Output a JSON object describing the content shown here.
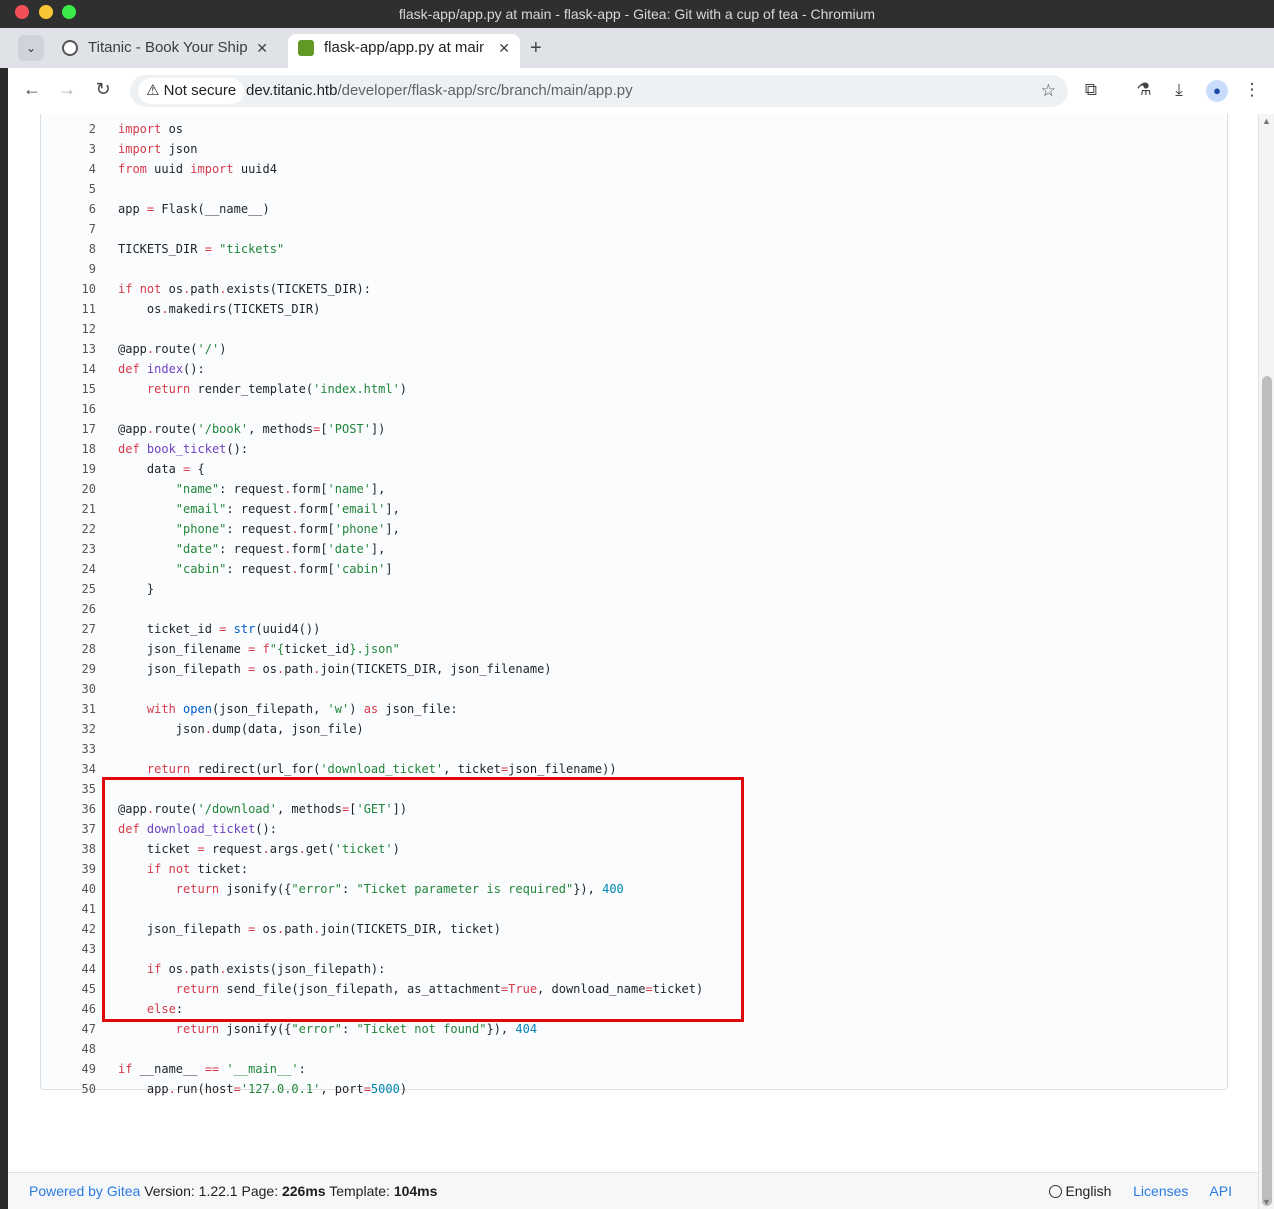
{
  "window": {
    "title": "flask-app/app.py at main - flask-app - Gitea: Git with a cup of tea - Chromium"
  },
  "tabs": [
    {
      "title": "Titanic - Book Your Ship T",
      "close": "✕"
    },
    {
      "title": "flask-app/app.py at main",
      "close": "✕"
    }
  ],
  "toolbar": {
    "not_secure": "Not secure",
    "url_host": "dev.titanic.htb",
    "url_path": "/developer/flask-app/src/branch/main/app.py"
  },
  "code": {
    "lines": [
      {
        "n": "2",
        "t": [
          [
            "k",
            "import"
          ],
          [
            "",
            " os"
          ]
        ]
      },
      {
        "n": "3",
        "t": [
          [
            "k",
            "import"
          ],
          [
            "",
            " json"
          ]
        ]
      },
      {
        "n": "4",
        "t": [
          [
            "k",
            "from"
          ],
          [
            "",
            " uuid "
          ],
          [
            "k",
            "import"
          ],
          [
            "",
            " uuid4"
          ]
        ]
      },
      {
        "n": "5",
        "t": []
      },
      {
        "n": "6",
        "t": [
          [
            "",
            "app "
          ],
          [
            "k",
            "="
          ],
          [
            "",
            " Flask(__name__)"
          ]
        ]
      },
      {
        "n": "7",
        "t": []
      },
      {
        "n": "8",
        "t": [
          [
            "",
            "TICKETS_DIR "
          ],
          [
            "k",
            "="
          ],
          [
            "",
            " "
          ],
          [
            "s",
            "\"tickets\""
          ]
        ]
      },
      {
        "n": "9",
        "t": []
      },
      {
        "n": "10",
        "t": [
          [
            "k",
            "if"
          ],
          [
            "",
            " "
          ],
          [
            "k",
            "not"
          ],
          [
            "",
            " os"
          ],
          [
            "k",
            "."
          ],
          [
            "",
            "path"
          ],
          [
            "k",
            "."
          ],
          [
            "",
            "exists(TICKETS_DIR):"
          ]
        ]
      },
      {
        "n": "11",
        "t": [
          [
            "",
            "    os"
          ],
          [
            "k",
            "."
          ],
          [
            "",
            "makedirs(TICKETS_DIR)"
          ]
        ]
      },
      {
        "n": "12",
        "t": []
      },
      {
        "n": "13",
        "t": [
          [
            "",
            "@app"
          ],
          [
            "k",
            "."
          ],
          [
            "",
            "route("
          ],
          [
            "s",
            "'/'"
          ],
          [
            "",
            ")"
          ]
        ]
      },
      {
        "n": "14",
        "t": [
          [
            "k",
            "def"
          ],
          [
            "",
            " "
          ],
          [
            "f",
            "index"
          ],
          [
            "",
            "():"
          ]
        ]
      },
      {
        "n": "15",
        "t": [
          [
            "",
            "    "
          ],
          [
            "k",
            "return"
          ],
          [
            "",
            " render_template("
          ],
          [
            "s",
            "'index.html'"
          ],
          [
            "",
            ")"
          ]
        ]
      },
      {
        "n": "16",
        "t": []
      },
      {
        "n": "17",
        "t": [
          [
            "",
            "@app"
          ],
          [
            "k",
            "."
          ],
          [
            "",
            "route("
          ],
          [
            "s",
            "'/book'"
          ],
          [
            "",
            ", methods"
          ],
          [
            "k",
            "="
          ],
          [
            "",
            "["
          ],
          [
            "s",
            "'POST'"
          ],
          [
            "",
            "])"
          ]
        ]
      },
      {
        "n": "18",
        "t": [
          [
            "k",
            "def"
          ],
          [
            "",
            " "
          ],
          [
            "f",
            "book_ticket"
          ],
          [
            "",
            "():"
          ]
        ]
      },
      {
        "n": "19",
        "t": [
          [
            "",
            "    data "
          ],
          [
            "k",
            "="
          ],
          [
            "",
            " {"
          ]
        ]
      },
      {
        "n": "20",
        "t": [
          [
            "",
            "        "
          ],
          [
            "s",
            "\"name\""
          ],
          [
            "",
            ": request"
          ],
          [
            "k",
            "."
          ],
          [
            "",
            "form["
          ],
          [
            "s",
            "'name'"
          ],
          [
            "",
            "],"
          ]
        ]
      },
      {
        "n": "21",
        "t": [
          [
            "",
            "        "
          ],
          [
            "s",
            "\"email\""
          ],
          [
            "",
            ": request"
          ],
          [
            "k",
            "."
          ],
          [
            "",
            "form["
          ],
          [
            "s",
            "'email'"
          ],
          [
            "",
            "],"
          ]
        ]
      },
      {
        "n": "22",
        "t": [
          [
            "",
            "        "
          ],
          [
            "s",
            "\"phone\""
          ],
          [
            "",
            ": request"
          ],
          [
            "k",
            "."
          ],
          [
            "",
            "form["
          ],
          [
            "s",
            "'phone'"
          ],
          [
            "",
            "],"
          ]
        ]
      },
      {
        "n": "23",
        "t": [
          [
            "",
            "        "
          ],
          [
            "s",
            "\"date\""
          ],
          [
            "",
            ": request"
          ],
          [
            "k",
            "."
          ],
          [
            "",
            "form["
          ],
          [
            "s",
            "'date'"
          ],
          [
            "",
            "],"
          ]
        ]
      },
      {
        "n": "24",
        "t": [
          [
            "",
            "        "
          ],
          [
            "s",
            "\"cabin\""
          ],
          [
            "",
            ": request"
          ],
          [
            "k",
            "."
          ],
          [
            "",
            "form["
          ],
          [
            "s",
            "'cabin'"
          ],
          [
            "",
            "]"
          ]
        ]
      },
      {
        "n": "25",
        "t": [
          [
            "",
            "    }"
          ]
        ]
      },
      {
        "n": "26",
        "t": []
      },
      {
        "n": "27",
        "t": [
          [
            "",
            "    ticket_id "
          ],
          [
            "k",
            "="
          ],
          [
            "",
            " "
          ],
          [
            "b",
            "str"
          ],
          [
            "",
            "(uuid4())"
          ]
        ]
      },
      {
        "n": "28",
        "t": [
          [
            "",
            "    json_filename "
          ],
          [
            "k",
            "="
          ],
          [
            "",
            " "
          ],
          [
            "k",
            "f"
          ],
          [
            "s",
            "\"{"
          ],
          [
            "",
            "ticket_id"
          ],
          [
            "s",
            "}.json\""
          ]
        ]
      },
      {
        "n": "29",
        "t": [
          [
            "",
            "    json_filepath "
          ],
          [
            "k",
            "="
          ],
          [
            "",
            " os"
          ],
          [
            "k",
            "."
          ],
          [
            "",
            "path"
          ],
          [
            "k",
            "."
          ],
          [
            "",
            "join(TICKETS_DIR, json_filename)"
          ]
        ]
      },
      {
        "n": "30",
        "t": []
      },
      {
        "n": "31",
        "t": [
          [
            "",
            "    "
          ],
          [
            "k",
            "with"
          ],
          [
            "",
            " "
          ],
          [
            "b",
            "open"
          ],
          [
            "",
            "(json_filepath, "
          ],
          [
            "s",
            "'w'"
          ],
          [
            "",
            ") "
          ],
          [
            "k",
            "as"
          ],
          [
            "",
            " json_file:"
          ]
        ]
      },
      {
        "n": "32",
        "t": [
          [
            "",
            "        json"
          ],
          [
            "k",
            "."
          ],
          [
            "",
            "dump(data, json_file)"
          ]
        ]
      },
      {
        "n": "33",
        "t": []
      },
      {
        "n": "34",
        "t": [
          [
            "",
            "    "
          ],
          [
            "k",
            "return"
          ],
          [
            "",
            " redirect(url_for("
          ],
          [
            "s",
            "'download_ticket'"
          ],
          [
            "",
            ", ticket"
          ],
          [
            "k",
            "="
          ],
          [
            "",
            "json_filename))"
          ]
        ]
      },
      {
        "n": "35",
        "t": []
      },
      {
        "n": "36",
        "t": [
          [
            "",
            "@app"
          ],
          [
            "k",
            "."
          ],
          [
            "",
            "route("
          ],
          [
            "s",
            "'/download'"
          ],
          [
            "",
            ", methods"
          ],
          [
            "k",
            "="
          ],
          [
            "",
            "["
          ],
          [
            "s",
            "'GET'"
          ],
          [
            "",
            "])"
          ]
        ]
      },
      {
        "n": "37",
        "t": [
          [
            "k",
            "def"
          ],
          [
            "",
            " "
          ],
          [
            "f",
            "download_ticket"
          ],
          [
            "",
            "():"
          ]
        ]
      },
      {
        "n": "38",
        "t": [
          [
            "",
            "    ticket "
          ],
          [
            "k",
            "="
          ],
          [
            "",
            " request"
          ],
          [
            "k",
            "."
          ],
          [
            "",
            "args"
          ],
          [
            "k",
            "."
          ],
          [
            "",
            "get("
          ],
          [
            "s",
            "'ticket'"
          ],
          [
            "",
            ")"
          ]
        ]
      },
      {
        "n": "39",
        "t": [
          [
            "",
            "    "
          ],
          [
            "k",
            "if"
          ],
          [
            "",
            " "
          ],
          [
            "k",
            "not"
          ],
          [
            "",
            " ticket:"
          ]
        ]
      },
      {
        "n": "40",
        "t": [
          [
            "",
            "        "
          ],
          [
            "k",
            "return"
          ],
          [
            "",
            " jsonify({"
          ],
          [
            "s",
            "\"error\""
          ],
          [
            "",
            ": "
          ],
          [
            "s",
            "\"Ticket parameter is required\""
          ],
          [
            "",
            "}), "
          ],
          [
            "n",
            "400"
          ]
        ]
      },
      {
        "n": "41",
        "t": []
      },
      {
        "n": "42",
        "t": [
          [
            "",
            "    json_filepath "
          ],
          [
            "k",
            "="
          ],
          [
            "",
            " os"
          ],
          [
            "k",
            "."
          ],
          [
            "",
            "path"
          ],
          [
            "k",
            "."
          ],
          [
            "",
            "join(TICKETS_DIR, ticket)"
          ]
        ]
      },
      {
        "n": "43",
        "t": []
      },
      {
        "n": "44",
        "t": [
          [
            "",
            "    "
          ],
          [
            "k",
            "if"
          ],
          [
            "",
            " os"
          ],
          [
            "k",
            "."
          ],
          [
            "",
            "path"
          ],
          [
            "k",
            "."
          ],
          [
            "",
            "exists(json_filepath):"
          ]
        ]
      },
      {
        "n": "45",
        "t": [
          [
            "",
            "        "
          ],
          [
            "k",
            "return"
          ],
          [
            "",
            " send_file(json_filepath, as_attachment"
          ],
          [
            "k",
            "=True"
          ],
          [
            "",
            ", download_name"
          ],
          [
            "k",
            "="
          ],
          [
            "",
            "ticket)"
          ]
        ]
      },
      {
        "n": "46",
        "t": [
          [
            "",
            "    "
          ],
          [
            "k",
            "else"
          ],
          [
            "",
            ":"
          ]
        ]
      },
      {
        "n": "47",
        "t": [
          [
            "",
            "        "
          ],
          [
            "k",
            "return"
          ],
          [
            "",
            " jsonify({"
          ],
          [
            "s",
            "\"error\""
          ],
          [
            "",
            ": "
          ],
          [
            "s",
            "\"Ticket not found\""
          ],
          [
            "",
            "}), "
          ],
          [
            "n",
            "404"
          ]
        ]
      },
      {
        "n": "48",
        "t": []
      },
      {
        "n": "49",
        "t": [
          [
            "k",
            "if"
          ],
          [
            "",
            " __name__ "
          ],
          [
            "k",
            "=="
          ],
          [
            "",
            " "
          ],
          [
            "s",
            "'__main__'"
          ],
          [
            "",
            ":"
          ]
        ]
      },
      {
        "n": "50",
        "t": [
          [
            "",
            "    app"
          ],
          [
            "k",
            "."
          ],
          [
            "",
            "run(host"
          ],
          [
            "k",
            "="
          ],
          [
            "s",
            "'127.0.0.1'"
          ],
          [
            "",
            ", port"
          ],
          [
            "k",
            "="
          ],
          [
            "n",
            "5000"
          ],
          [
            "",
            ")"
          ]
        ]
      }
    ]
  },
  "footer": {
    "powered": "Powered by Gitea",
    "version_label": "Version:",
    "version": "1.22.1",
    "page_label": "Page:",
    "page_time": "226ms",
    "template_label": "Template:",
    "template_time": "104ms",
    "language": "English",
    "licenses": "Licenses",
    "api": "API"
  },
  "colors": {
    "keyword": "#d73a49",
    "function": "#6f42c1",
    "string": "#22863a",
    "number": "#0086b3",
    "highlight_box": "#e0080b",
    "link": "#2a7ae2"
  }
}
